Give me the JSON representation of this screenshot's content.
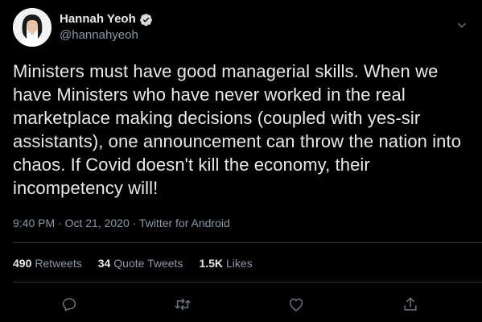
{
  "author": {
    "display_name": "Hannah Yeoh",
    "handle": "@hannahyeoh",
    "verified": true
  },
  "tweet": {
    "text": "Ministers must have good managerial skills. When we have Ministers who have never worked in the real marketplace making decisions (coupled with yes-sir assistants), one announcement can throw the nation into chaos. If Covid doesn't kill the economy, their incompetency will!",
    "time": "9:40 PM",
    "date": "Oct 21, 2020",
    "source": "Twitter for Android",
    "meta_line": "9:40 PM · Oct 21, 2020 · Twitter for Android"
  },
  "stats": {
    "retweets_count": "490",
    "retweets_label": "Retweets",
    "quotes_count": "34",
    "quotes_label": "Quote Tweets",
    "likes_count": "1.5K",
    "likes_label": "Likes"
  },
  "icons": {
    "verified": "verified-badge-icon",
    "menu": "chevron-down-icon",
    "reply": "reply-icon",
    "retweet": "retweet-icon",
    "like": "heart-icon",
    "share": "share-icon"
  },
  "colors": {
    "background": "#000000",
    "text_primary": "#e7e9ea",
    "text_secondary": "#8b98a5",
    "divider": "#2f3336",
    "verified": "#d9d9d9"
  }
}
